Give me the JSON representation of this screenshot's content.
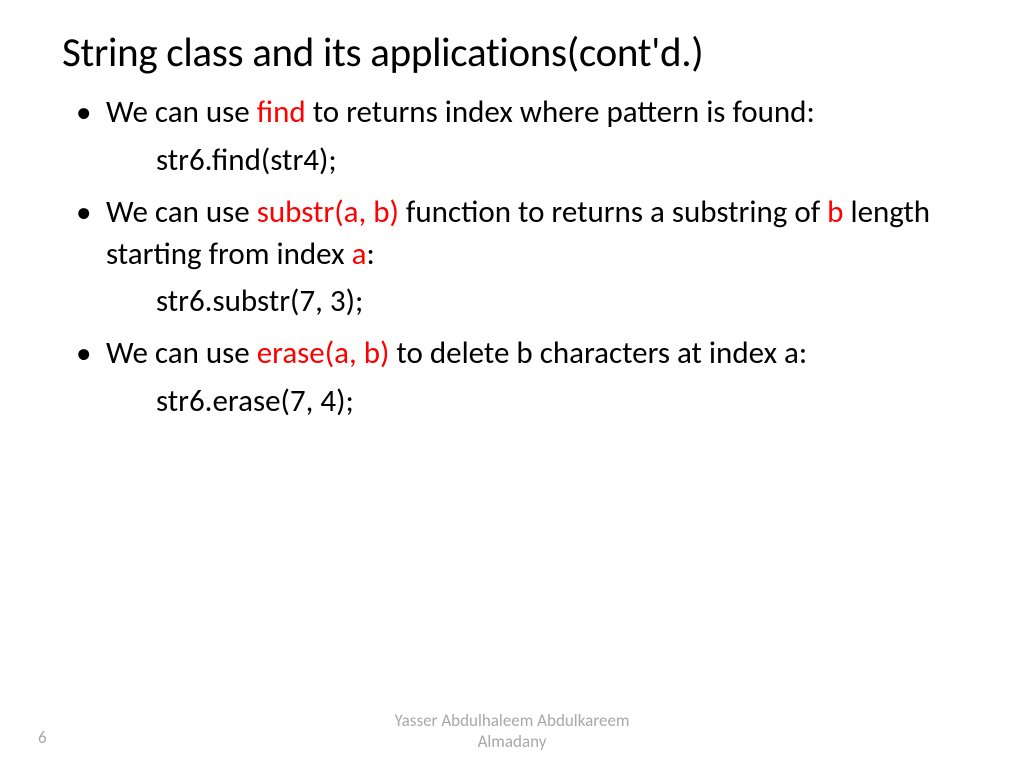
{
  "title": "String class and its applications(cont'd.)",
  "bullets": [
    {
      "pre1": "We can use ",
      "hl1": "find",
      "post1": " to returns index where pattern is found:",
      "code": "str6.find(str4);"
    },
    {
      "pre1": "We can use ",
      "hl1": "substr(a, b)",
      "mid1": " function to returns a substring of ",
      "hl2": "b",
      "mid2": " length starting from index ",
      "hl3": "a",
      "post1": ":",
      "code": "str6.substr(7, 3);"
    },
    {
      "pre1": "We can use ",
      "hl1": "erase(a, b)",
      "post1": " to delete b characters at index a:",
      "code": "str6.erase(7, 4);"
    }
  ],
  "footer": {
    "page": "6",
    "author_line1": "Yasser Abdulhaleem Abdulkareem",
    "author_line2": "Almadany"
  }
}
